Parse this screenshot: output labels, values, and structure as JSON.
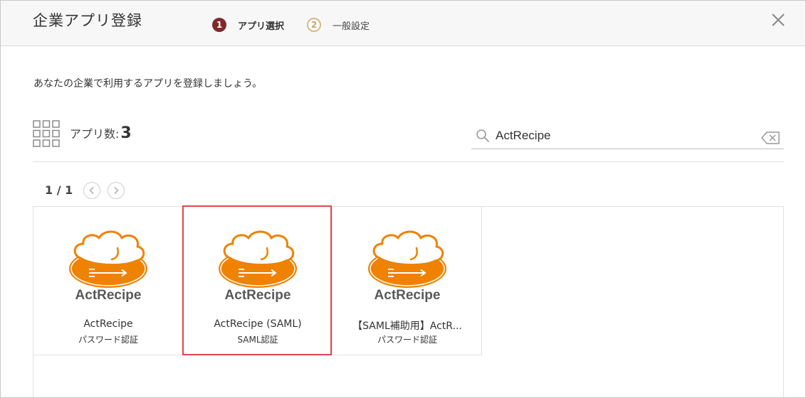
{
  "header": {
    "title": "企業アプリ登録",
    "steps": [
      {
        "num": "1",
        "label": "アプリ選択"
      },
      {
        "num": "2",
        "label": "一般設定"
      }
    ]
  },
  "description": "あなたの企業で利用するアプリを登録しましょう。",
  "count": {
    "label": "アプリ数:",
    "value": "3"
  },
  "search": {
    "value": "ActRecipe"
  },
  "pager": {
    "text": "1 / 1"
  },
  "apps": [
    {
      "name": "ActRecipe",
      "type": "パスワード認証",
      "logo_text": "ActRecipe"
    },
    {
      "name": "ActRecipe (SAML)",
      "type": "SAML認証",
      "logo_text": "ActRecipe"
    },
    {
      "name": "【SAML補助用】ActR...",
      "type": "パスワード認証",
      "logo_text": "ActRecipe"
    }
  ],
  "colors": {
    "step_active": "#7d2a2c",
    "step_inactive": "#d7b98a",
    "logo_orange": "#ef8200",
    "highlight": "#e0474c"
  }
}
